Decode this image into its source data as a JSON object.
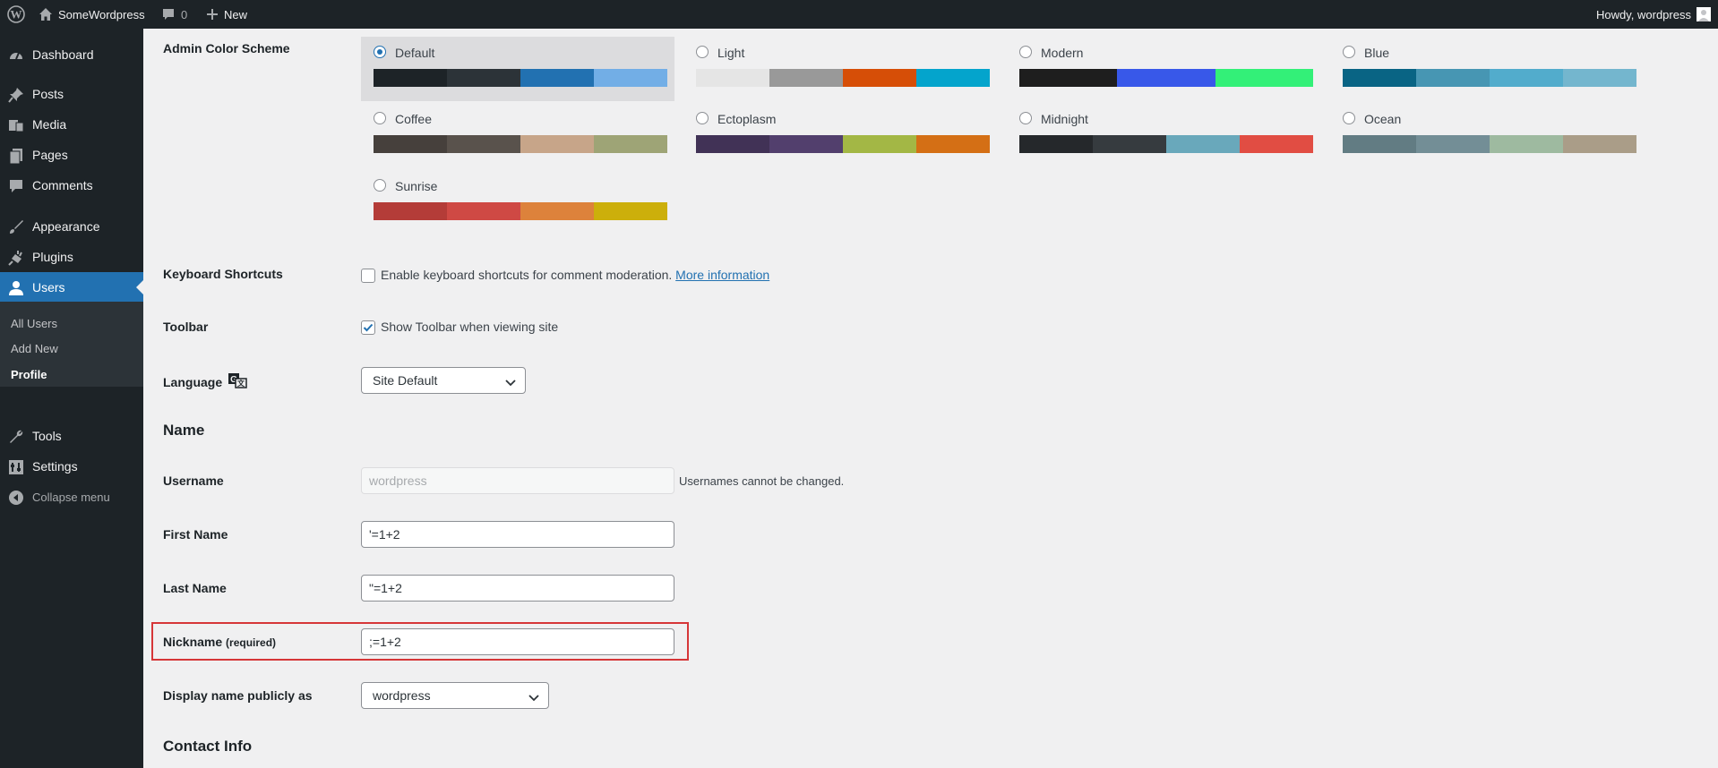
{
  "admin_bar": {
    "site_name": "SomeWordpress",
    "comments_count": "0",
    "new_label": "New",
    "howdy": "Howdy, wordpress"
  },
  "sidebar": {
    "items": [
      {
        "label": "Dashboard",
        "icon": "dashboard-icon"
      },
      {
        "label": "Posts",
        "icon": "pin-icon"
      },
      {
        "label": "Media",
        "icon": "media-icon"
      },
      {
        "label": "Pages",
        "icon": "pages-icon"
      },
      {
        "label": "Comments",
        "icon": "comment-icon"
      },
      {
        "label": "Appearance",
        "icon": "brush-icon"
      },
      {
        "label": "Plugins",
        "icon": "plug-icon"
      },
      {
        "label": "Users",
        "icon": "user-icon"
      },
      {
        "label": "Tools",
        "icon": "wrench-icon"
      },
      {
        "label": "Settings",
        "icon": "settings-icon"
      },
      {
        "label": "Collapse menu",
        "icon": "collapse-icon"
      }
    ],
    "submenu": [
      "All Users",
      "Add New",
      "Profile"
    ]
  },
  "colors": {
    "accent": "#2271b1",
    "highlight": "#d63638"
  },
  "color_scheme": {
    "label": "Admin Color Scheme",
    "schemes": [
      {
        "name": "Default",
        "selected": true,
        "colors": [
          "#1d2327",
          "#2c3338",
          "#2271b1",
          "#72aee6"
        ]
      },
      {
        "name": "Light",
        "selected": false,
        "colors": [
          "#e5e5e5",
          "#999999",
          "#d64e07",
          "#04a4cc"
        ]
      },
      {
        "name": "Modern",
        "selected": false,
        "colors": [
          "#1e1e1e",
          "#3858e9",
          "#33f078"
        ]
      },
      {
        "name": "Blue",
        "selected": false,
        "colors": [
          "#096484",
          "#4796b3",
          "#52accc",
          "#74b6ce"
        ]
      },
      {
        "name": "Coffee",
        "selected": false,
        "colors": [
          "#46403c",
          "#59524c",
          "#c7a589",
          "#9ea476"
        ]
      },
      {
        "name": "Ectoplasm",
        "selected": false,
        "colors": [
          "#413256",
          "#523f6d",
          "#a3b745",
          "#d46f15"
        ]
      },
      {
        "name": "Midnight",
        "selected": false,
        "colors": [
          "#25282b",
          "#363b3f",
          "#69a8bb",
          "#e14d43"
        ]
      },
      {
        "name": "Ocean",
        "selected": false,
        "colors": [
          "#627c83",
          "#738e96",
          "#9ebaa0",
          "#aa9d88"
        ]
      },
      {
        "name": "Sunrise",
        "selected": false,
        "colors": [
          "#b43c38",
          "#cf4944",
          "#dd823b",
          "#ccaf0b"
        ]
      }
    ]
  },
  "keyboard_shortcuts": {
    "label": "Keyboard Shortcuts",
    "checkbox_label": "Enable keyboard shortcuts for comment moderation.",
    "link_text": "More information",
    "checked": false
  },
  "toolbar": {
    "label": "Toolbar",
    "checkbox_label": "Show Toolbar when viewing site",
    "checked": true
  },
  "language": {
    "label": "Language",
    "value": "Site Default"
  },
  "name_section": {
    "heading": "Name",
    "username_label": "Username",
    "username_value": "wordpress",
    "username_desc": "Usernames cannot be changed.",
    "first_name_label": "First Name",
    "first_name_value": "'=1+2",
    "last_name_label": "Last Name",
    "last_name_value": "\"=1+2",
    "nickname_label": "Nickname",
    "nickname_required": "(required)",
    "nickname_value": ";=1+2",
    "display_name_label": "Display name publicly as",
    "display_name_value": "wordpress"
  },
  "contact_section": {
    "heading": "Contact Info"
  }
}
